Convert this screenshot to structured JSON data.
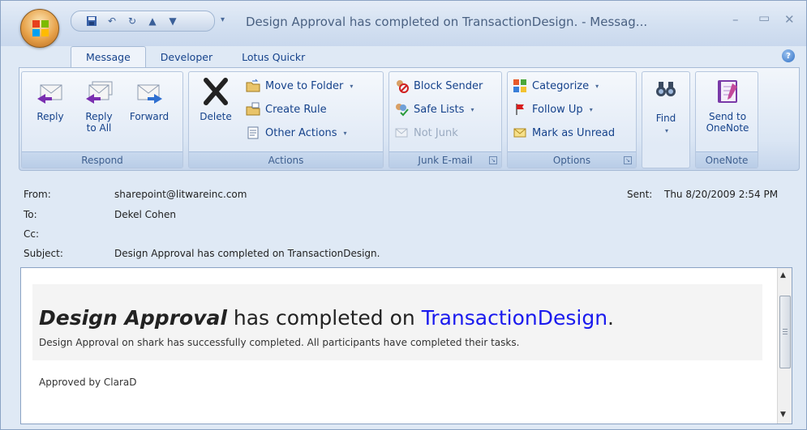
{
  "window": {
    "title": "Design Approval has completed on TransactionDesign. - Messag...",
    "controls": [
      "minimize-icon",
      "maximize-icon",
      "close-icon"
    ]
  },
  "qat": {
    "icons": [
      "save-icon",
      "undo-icon",
      "redo-icon",
      "previous-item-icon",
      "next-item-icon"
    ]
  },
  "tabs": [
    {
      "label": "Message",
      "active": true
    },
    {
      "label": "Developer",
      "active": false
    },
    {
      "label": "Lotus Quickr",
      "active": false
    }
  ],
  "ribbon": {
    "respond": {
      "label": "Respond",
      "reply": "Reply",
      "reply_all_line1": "Reply",
      "reply_all_line2": "to All",
      "forward": "Forward"
    },
    "actions": {
      "label": "Actions",
      "delete": "Delete",
      "move_to_folder": "Move to Folder",
      "create_rule": "Create Rule",
      "other_actions": "Other Actions"
    },
    "junk": {
      "label": "Junk E-mail",
      "block_sender": "Block Sender",
      "safe_lists": "Safe Lists",
      "not_junk": "Not Junk"
    },
    "options": {
      "label": "Options",
      "categorize": "Categorize",
      "follow_up": "Follow Up",
      "mark_unread": "Mark as Unread"
    },
    "find": {
      "label": "Find"
    },
    "onenote": {
      "label": "OneNote",
      "send_line1": "Send to",
      "send_line2": "OneNote"
    }
  },
  "headers": {
    "from_label": "From:",
    "from_value": "sharepoint@litwareinc.com",
    "to_label": "To:",
    "to_value": "Dekel Cohen",
    "cc_label": "Cc:",
    "cc_value": "",
    "subject_label": "Subject:",
    "subject_value": "Design Approval has completed on TransactionDesign.",
    "sent_label": "Sent:",
    "sent_value": "Thu 8/20/2009 2:54 PM"
  },
  "body": {
    "headline_bold": "Design Approval",
    "headline_middle": " has completed on ",
    "headline_link": "TransactionDesign",
    "headline_end": ".",
    "subline": "Design Approval on shark has successfully completed. All participants have completed their tasks.",
    "approved": "Approved by ClaraD"
  }
}
